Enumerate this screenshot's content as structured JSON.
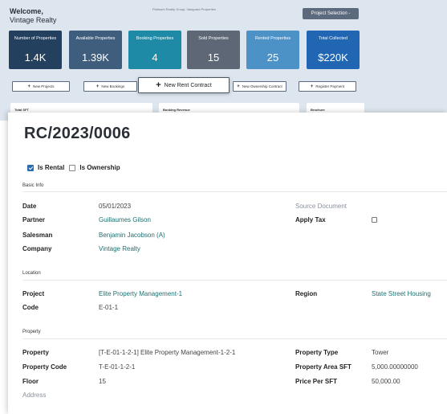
{
  "dashboard": {
    "welcome_line1": "Welcome,",
    "welcome_line2": "Vintage Realty",
    "banner_text": "Platinum Realty Group, Vanguard Properties",
    "project_selection": "Project Selection -",
    "cards": [
      {
        "title": "Number of Properties",
        "value": "1.4K"
      },
      {
        "title": "Available Properties",
        "value": "1.39K"
      },
      {
        "title": "Booking Properties",
        "value": "4"
      },
      {
        "title": "Sold Properties",
        "value": "15"
      },
      {
        "title": "Rented Properties",
        "value": "25"
      },
      {
        "title": "Total Collected",
        "value": "$220K"
      }
    ],
    "quick_buttons": {
      "new_projects": "New Projects",
      "new_bookings": "New Bookings",
      "new_rent_contract": "New Rent Contract",
      "new_ownership_contract": "New Ownership Contract",
      "register_payment": "Register Payment"
    },
    "panels": {
      "total_sft": "Total SFT",
      "booking_revenue": "Booking Revenue",
      "brochure": "Brochure"
    }
  },
  "form": {
    "reference": "RC/2023/0006",
    "is_rental_label": "Is Rental",
    "is_rental": true,
    "is_ownership_label": "Is Ownership",
    "is_ownership": false,
    "sections": {
      "basic_info": "Basic Info",
      "location": "Location",
      "property": "Property"
    },
    "basic": {
      "date_label": "Date",
      "date": "05/01/2023",
      "partner_label": "Partner",
      "partner": "Guillaumes Gilson",
      "salesman_label": "Salesman",
      "salesman": "Benjamin Jacobson (A)",
      "company_label": "Company",
      "company": "Vintage Realty",
      "source_document_label": "Source Document",
      "apply_tax_label": "Apply Tax",
      "apply_tax": false
    },
    "location": {
      "project_label": "Project",
      "project": "Elite Property Management-1",
      "code_label": "Code",
      "code": "E-01-1",
      "region_label": "Region",
      "region": "State Street Housing"
    },
    "property": {
      "property_label": "Property",
      "property": "[T-E-01-1-2-1] Elite Property Management-1-2-1",
      "property_code_label": "Property Code",
      "property_code": "T-E-01-1-2-1",
      "floor_label": "Floor",
      "floor": "15",
      "address_label": "Address",
      "property_type_label": "Property Type",
      "property_type": "Tower",
      "property_area_label": "Property Area SFT",
      "property_area": "5,000.00000000",
      "price_per_sft_label": "Price Per SFT",
      "price_per_sft": "50,000.00"
    }
  },
  "colors": {
    "dashboard_bg": "#dde5ee",
    "link": "#1f6f6f",
    "checkbox_on": "#2b6cb0"
  }
}
